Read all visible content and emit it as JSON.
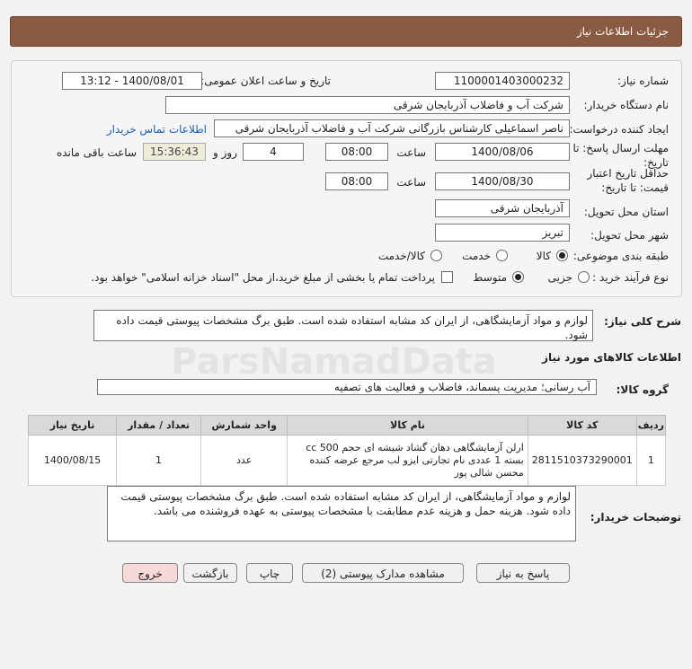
{
  "header": {
    "title": "جزئیات اطلاعات نیاز"
  },
  "form": {
    "need_number_label": "شماره نیاز:",
    "need_number": "1100001403000232",
    "announce_label": "تاریخ و ساعت اعلان عمومی:",
    "announce_value": "1400/08/01 - 13:12",
    "buyer_org_label": "نام دستگاه خریدار:",
    "buyer_org": "شرکت آب و فاضلاب آذربایجان شرقی",
    "creator_label": "ایجاد کننده درخواست:",
    "creator": "ناصر اسماعیلی کارشناس بازرگانی شرکت آب و فاضلاب آذربایجان شرقی",
    "contact_link": "اطلاعات تماس خریدار",
    "deadline_label_1": "مهلت ارسال پاسخ: تا",
    "deadline_label_2": "تاریخ:",
    "deadline_date": "1400/08/06",
    "time_label": "ساعت",
    "deadline_time": "08:00",
    "days_value": "4",
    "days_label": "روز و",
    "remaining_time": "15:36:43",
    "remaining_label": "ساعت باقی مانده",
    "validity_label_1": "حداقل تاریخ اعتبار",
    "validity_label_2": "قیمت: تا تاریخ:",
    "validity_date": "1400/08/30",
    "validity_time": "08:00",
    "province_label": "استان محل تحویل:",
    "province": "آذربایجان شرقی",
    "city_label": "شهر محل تحویل:",
    "city": "تبریز",
    "category_label": "طبقه بندی موضوعی:",
    "category_options": [
      "کالا",
      "خدمت",
      "کالا/خدمت"
    ],
    "category_selected": "کالا",
    "process_label": "نوع فرآیند خرید :",
    "process_options": [
      "جزیی",
      "متوسط"
    ],
    "process_selected": "متوسط",
    "payment_note": "پرداخت تمام یا بخشی از مبلغ خرید،از محل \"اسناد خزانه اسلامی\" خواهد بود."
  },
  "summary": {
    "label": "شرح کلی نیاز:",
    "text": "لوازم و مواد آزمایشگاهی، از ایران کد مشابه استفاده شده است. طبق برگ مشخصات پیوستی قیمت داده شود."
  },
  "goods": {
    "section_title": "اطلاعات کالاهای مورد نیاز",
    "group_label": "گروه کالا:",
    "group_value": "آب رسانی؛ مدیریت پسماند، فاضلاب و فعالیت های تصفیه"
  },
  "table": {
    "headers": [
      "ردیف",
      "کد کالا",
      "نام کالا",
      "واحد شمارش",
      "تعداد / مقدار",
      "تاریخ نیاز"
    ],
    "rows": [
      {
        "row": "1",
        "code": "2811510373290001",
        "name": "ارلن آزمایشگاهی دهان گشاد شیشه ای حجم cc 500 بسته 1 عددی نام تجارتی ایزو لب مرجع عرضه کننده محسن شالی پور",
        "unit": "عدد",
        "qty": "1",
        "date": "1400/08/15"
      }
    ]
  },
  "buyer_notes": {
    "label": "توضیحات خریدار:",
    "text": "لوازم و مواد آزمایشگاهی، از ایران کد مشابه استفاده شده است. طبق برگ مشخصات پیوستی قیمت داده شود. هزینه حمل و هزینه عدم مطابقت با مشخصات پیوستی به عهده فروشنده می باشد."
  },
  "buttons": {
    "reply": "پاسخ به نیاز",
    "attachments": "مشاهده مدارک پیوستی (2)",
    "print": "چاپ",
    "back": "بازگشت",
    "exit": "خروج"
  },
  "watermark": "ParsNamadData",
  "colors": {
    "header_bg": "#8b5a43",
    "link": "#1a5fb4",
    "pink_button": "#f7d9d9"
  }
}
